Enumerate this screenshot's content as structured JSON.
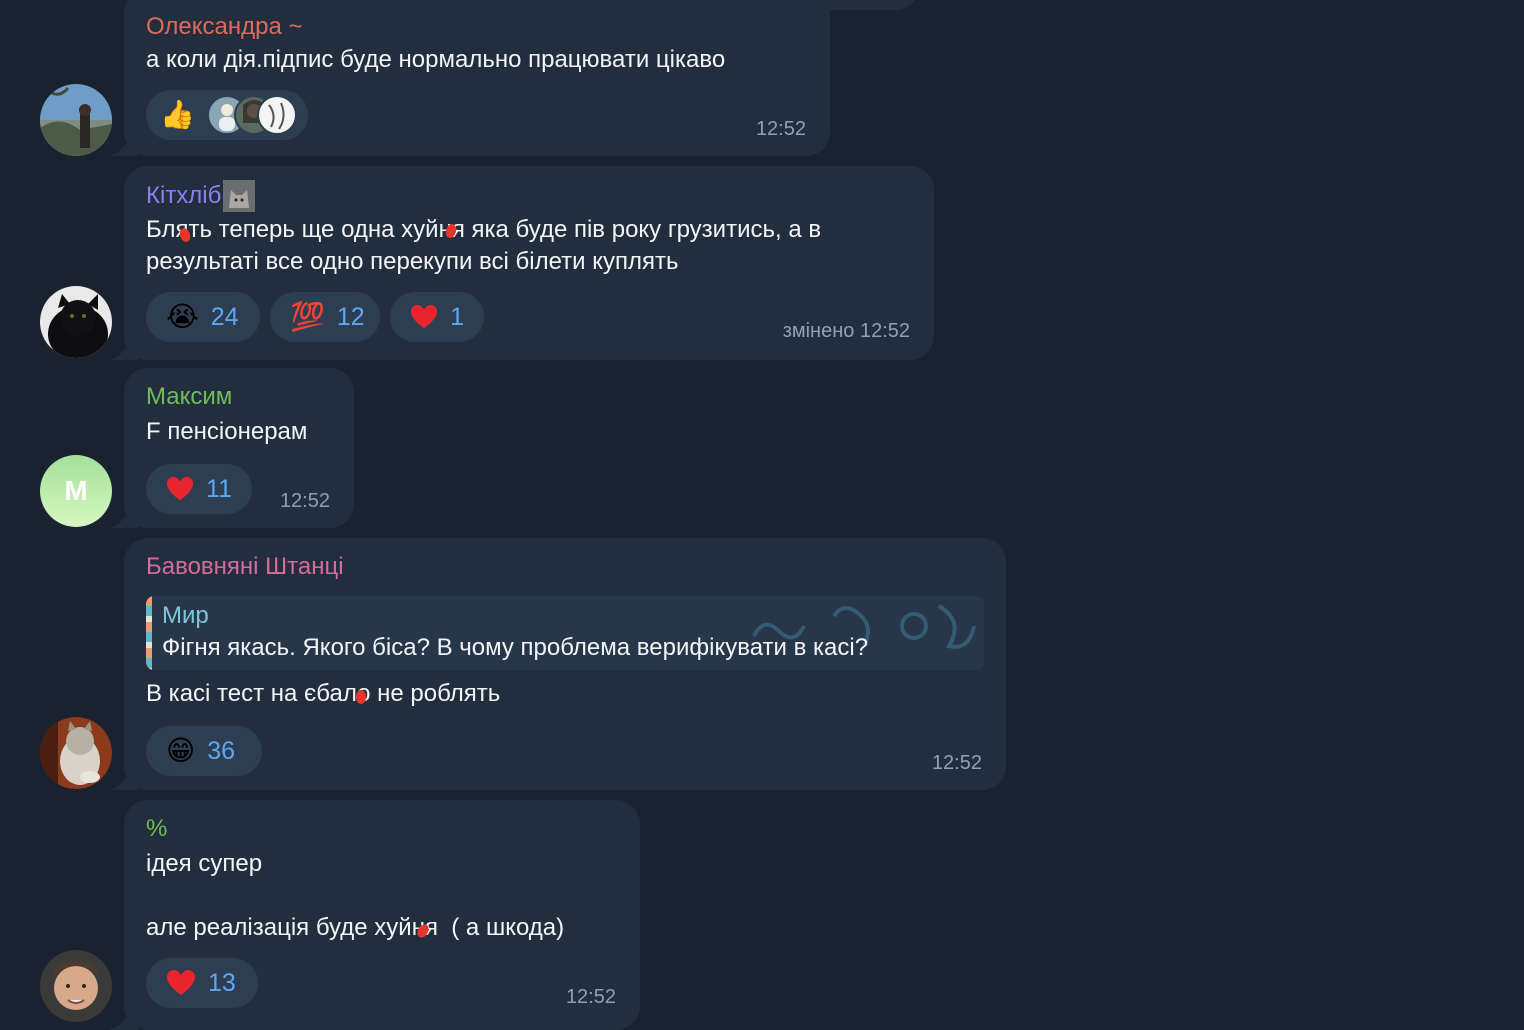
{
  "colors": {
    "background": "#1a2230",
    "bubble": "#222e3d",
    "reaction_pill": "#2d3d52",
    "reaction_count": "#5fa8f0",
    "time": "#8ea0b3"
  },
  "messages": [
    {
      "sender": "Олександра ~",
      "sender_color": "#e0685d",
      "text": "а коли дія.підпис буде нормально працювати цікаво",
      "reactions": [
        {
          "emoji": "👍",
          "avatars": true
        }
      ],
      "time": "12:52"
    },
    {
      "sender": "Кітхліб",
      "sender_color": "#8f7ef2",
      "text": "Блять теперь ще одна хуйня яка буде пів року грузитись, а в\nрезультаті все одно перекупи всі білети куплять",
      "reactions": [
        {
          "emoji": "😭",
          "count": "24"
        },
        {
          "emoji": "💯",
          "count": "12"
        },
        {
          "emoji": "heart",
          "count": "1"
        }
      ],
      "time": "змінено 12:52"
    },
    {
      "sender": "Максим",
      "sender_color": "#6fbd5a",
      "avatar_letter": "M",
      "text": "F пенсіонерам",
      "reactions": [
        {
          "emoji": "heart",
          "count": "11"
        }
      ],
      "time": "12:52"
    },
    {
      "sender": "Бавовняні Штанці",
      "sender_color": "#d86b9c",
      "reply": {
        "name": "Мир",
        "text": "Фігня якась.  Якого біса? В чому проблема верифікувати в касі?"
      },
      "text": "В касі тест на єбало не роблять",
      "reactions": [
        {
          "emoji": "😁",
          "count": "36"
        }
      ],
      "time": "12:52"
    },
    {
      "sender": "%",
      "sender_color": "#6fbd5a",
      "text": "ідея супер\n\nале реалізація буде хуйня  ( а шкода)",
      "reactions": [
        {
          "emoji": "heart",
          "count": "13"
        }
      ],
      "time": "12:52"
    }
  ]
}
